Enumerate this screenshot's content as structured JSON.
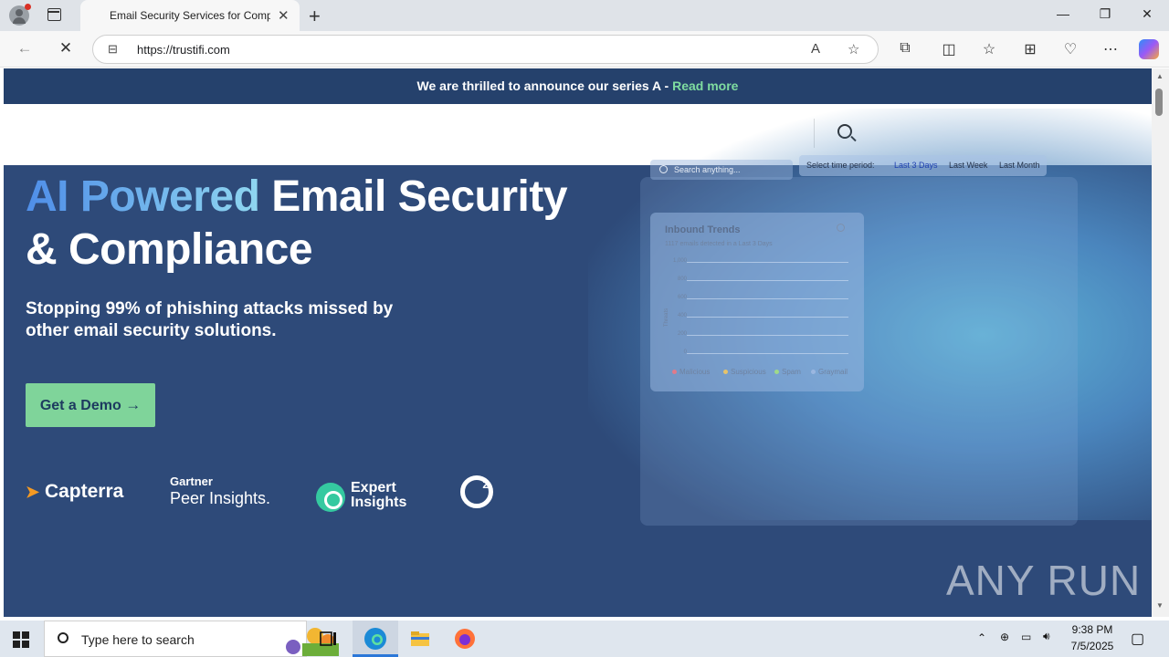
{
  "browser": {
    "tab_title": "Email Security Services for Compa",
    "tab_close": "✕",
    "new_tab": "+",
    "url": "https://trustifi.com",
    "window_controls": {
      "minimize": "—",
      "restore": "❐",
      "close": "✕"
    }
  },
  "site": {
    "announcement": {
      "text": "We are thrilled to announce our series A - ",
      "link": "Read more"
    },
    "hero": {
      "headline_accent": "AI Powered",
      "headline_rest": " Email Security & Compliance",
      "subheadline": "Stopping 99% of phishing attacks missed by other email security solutions.",
      "cta_label": "Get a Demo",
      "cta_arrow": "→"
    },
    "logos": {
      "capterra": "Capterra",
      "gartner_top": "Gartner",
      "gartner_bottom": "Peer Insights.",
      "expert_top": "Expert",
      "expert_bottom": "Insights",
      "g2": "2"
    },
    "dashboard": {
      "search_placeholder": "Search anything...",
      "period_label": "Select time period:",
      "period_options": [
        "Last 3 Days",
        "Last Week",
        "Last Month"
      ],
      "active_period": "Last 3 Days",
      "card_title": "Inbound Trends",
      "card_subtitle": "1117 emails detected in a Last 3 Days",
      "y_axis_label": "Threats",
      "y_ticks": [
        "1,000",
        "800",
        "600",
        "400",
        "200",
        "0"
      ],
      "legend": [
        "Malicious",
        "Suspicious",
        "Spam",
        "Graymail"
      ],
      "legend_colors": [
        "#e07a8a",
        "#e6c36a",
        "#9fd98a",
        "#9bb7e0"
      ]
    }
  },
  "watermark": "ANY RUN",
  "taskbar": {
    "search_placeholder": "Type here to search",
    "time": "9:38 PM",
    "date": "7/5/2025"
  },
  "colors": {
    "hero_bg": "#2e4a79",
    "announce_bg": "#25416c",
    "cta_bg": "#7fd49a",
    "link_green": "#7fdca0"
  }
}
